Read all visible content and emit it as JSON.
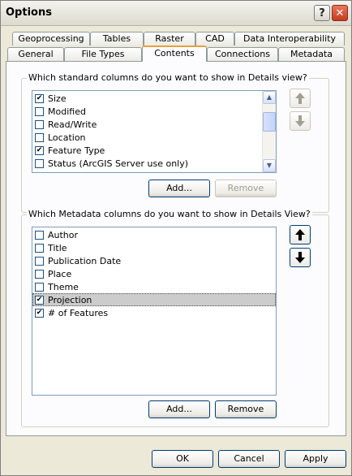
{
  "window": {
    "title": "Options"
  },
  "titlebar": {
    "help_label": "?",
    "close_label": "✕"
  },
  "tabs": {
    "back_row": [
      "Geoprocessing",
      "Tables",
      "Raster",
      "CAD",
      "Data Interoperability"
    ],
    "front_row": [
      "General",
      "File Types",
      "Contents",
      "Connections",
      "Metadata"
    ],
    "active": "Contents"
  },
  "standard_columns": {
    "prompt": "Which standard columns do you want to show in Details view?",
    "items": [
      {
        "label": "Size",
        "checked": true
      },
      {
        "label": "Modified",
        "checked": false
      },
      {
        "label": "Read/Write",
        "checked": false
      },
      {
        "label": "Location",
        "checked": false
      },
      {
        "label": "Feature Type",
        "checked": true
      },
      {
        "label": "Status (ArcGIS Server use only)",
        "checked": false
      }
    ],
    "add_label": "Add...",
    "remove_label": "Remove"
  },
  "metadata_columns": {
    "prompt": "Which Metadata columns do you want to show in Details View?",
    "items": [
      {
        "label": "Author",
        "checked": false
      },
      {
        "label": "Title",
        "checked": false
      },
      {
        "label": "Publication Date",
        "checked": false
      },
      {
        "label": "Place",
        "checked": false
      },
      {
        "label": "Theme",
        "checked": false
      },
      {
        "label": "Projection",
        "checked": true,
        "selected": true
      },
      {
        "label": "# of Features",
        "checked": true
      }
    ],
    "add_label": "Add...",
    "remove_label": "Remove"
  },
  "footer": {
    "ok_label": "OK",
    "cancel_label": "Cancel",
    "apply_label": "Apply"
  }
}
